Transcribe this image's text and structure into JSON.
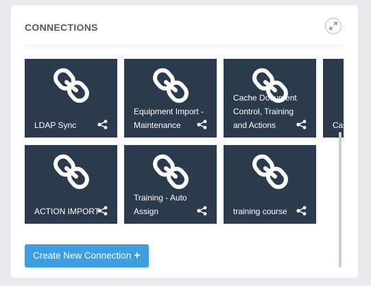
{
  "panel": {
    "title": "CONNECTIONS",
    "expand_icon": "expand-arrows-icon"
  },
  "tiles": [
    {
      "label": "LDAP Sync"
    },
    {
      "label": "Equipment Import - Maintenance"
    },
    {
      "label": "Cache Document Control, Training and Actions"
    },
    {
      "label": "Cache Tasks Rules"
    },
    {
      "label": "ACTION IMPORT"
    },
    {
      "label": "Training - Auto Assign"
    },
    {
      "label": "training course"
    }
  ],
  "icons": {
    "tile_main": "chain-link-icon",
    "tile_share": "share-nodes-icon",
    "create": "plus-icon"
  },
  "create_button": {
    "label": "Create New Connection",
    "plus": "+"
  },
  "colors": {
    "tile_bg": "#2c3a4d",
    "button_bg": "#3f9ee0",
    "title": "#555a60"
  }
}
